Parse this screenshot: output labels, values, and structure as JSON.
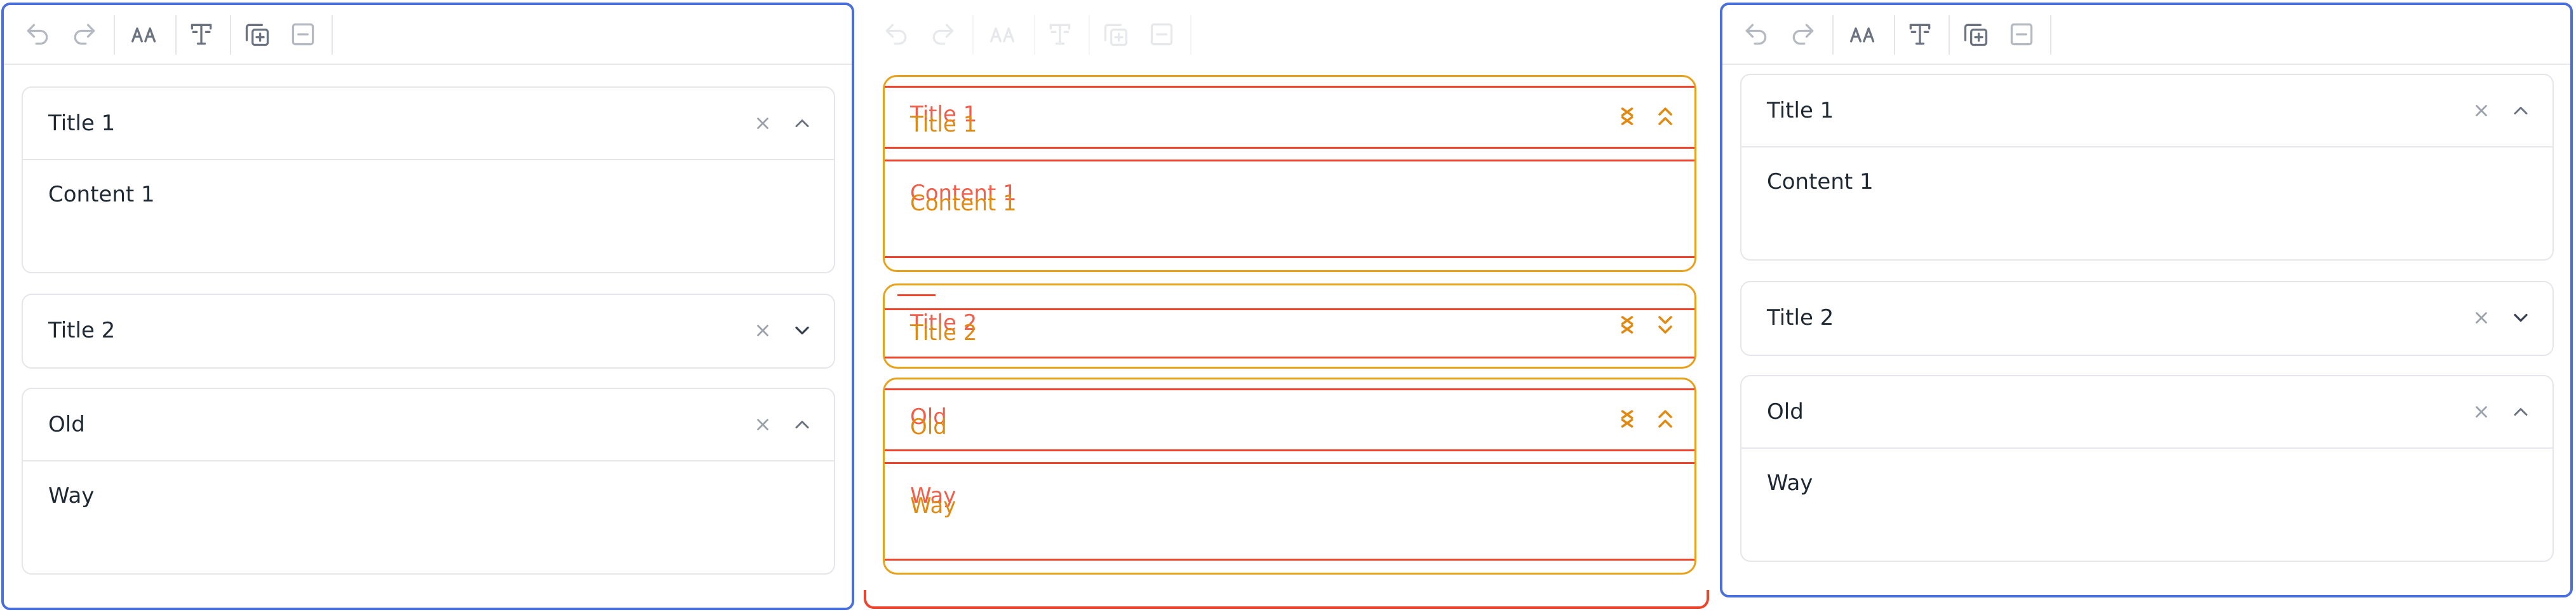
{
  "toolbar": {
    "buttons": [
      {
        "name": "undo-button",
        "icon": "undo-icon"
      },
      {
        "name": "redo-button",
        "icon": "redo-icon"
      },
      {
        "name": "font-size-button",
        "icon": "font-size-icon"
      },
      {
        "name": "text-style-button",
        "icon": "text-style-icon"
      },
      {
        "name": "add-item-button",
        "icon": "add-item-icon"
      },
      {
        "name": "remove-item-button",
        "icon": "remove-item-icon"
      }
    ]
  },
  "panels": {
    "left": {
      "items": [
        {
          "title": "Title 1",
          "content": "Content 1",
          "expanded": true
        },
        {
          "title": "Title 2",
          "content": "",
          "expanded": false
        },
        {
          "title": "Old",
          "content": "Way",
          "expanded": true
        }
      ]
    },
    "middle": {
      "items": [
        {
          "title": "Title 1",
          "content": "Content 1",
          "expanded": true
        },
        {
          "title": "Title 2",
          "content": "",
          "expanded": false
        },
        {
          "title": "Old",
          "content": "Way",
          "expanded": true
        }
      ]
    },
    "right": {
      "items": [
        {
          "title": "Title 1",
          "content": "Content 1",
          "expanded": true
        },
        {
          "title": "Title 2",
          "content": "",
          "expanded": false
        },
        {
          "title": "Old",
          "content": "Way",
          "expanded": true
        }
      ]
    }
  },
  "colors": {
    "focus_border": "#4a6fdc",
    "debug_outline": "#e8a21a",
    "debug_line": "#f0432b",
    "text": "#1f2933",
    "icon": "#9aa1ab"
  }
}
